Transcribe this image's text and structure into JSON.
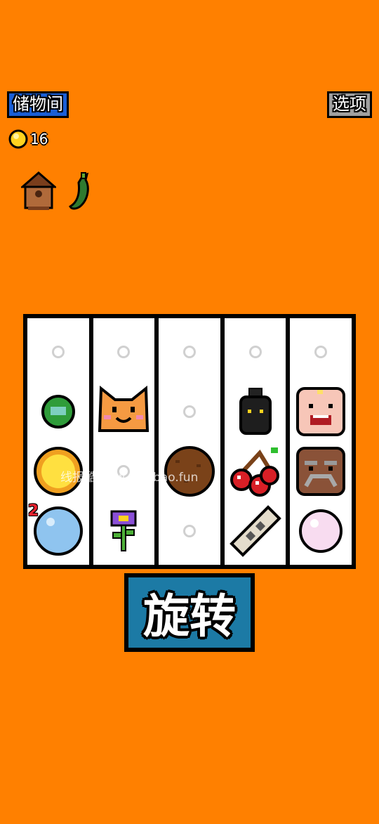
{
  "header": {
    "storage_label": "储物间",
    "options_label": "选项"
  },
  "coins": {
    "count": "16",
    "icon": "coin-icon"
  },
  "relics": [
    {
      "icon": "birdhouse-icon"
    },
    {
      "icon": "chili-pepper-icon"
    }
  ],
  "board": {
    "reels": [
      [
        {
          "symbol": "empty"
        },
        {
          "symbol": "green-pearl"
        },
        {
          "symbol": "gold-coin"
        },
        {
          "symbol": "bubble",
          "count": "2"
        }
      ],
      [
        {
          "symbol": "empty"
        },
        {
          "symbol": "cat"
        },
        {
          "symbol": "empty"
        },
        {
          "symbol": "flower"
        }
      ],
      [
        {
          "symbol": "empty"
        },
        {
          "symbol": "empty"
        },
        {
          "symbol": "coconut"
        },
        {
          "symbol": "empty"
        }
      ],
      [
        {
          "symbol": "empty"
        },
        {
          "symbol": "black-bomb"
        },
        {
          "symbol": "cherry"
        },
        {
          "symbol": "seed-pod"
        }
      ],
      [
        {
          "symbol": "empty"
        },
        {
          "symbol": "baby-face"
        },
        {
          "symbol": "old-man-face"
        },
        {
          "symbol": "pink-pearl"
        }
      ]
    ]
  },
  "watermark": "线报酷-new.xianbao.fun",
  "spin_label": "旋转",
  "colors": {
    "background": "#ff8000",
    "storage_button": "#1a5fd6",
    "options_button": "#a0a0a0",
    "spin_button": "#1c7aa5"
  }
}
